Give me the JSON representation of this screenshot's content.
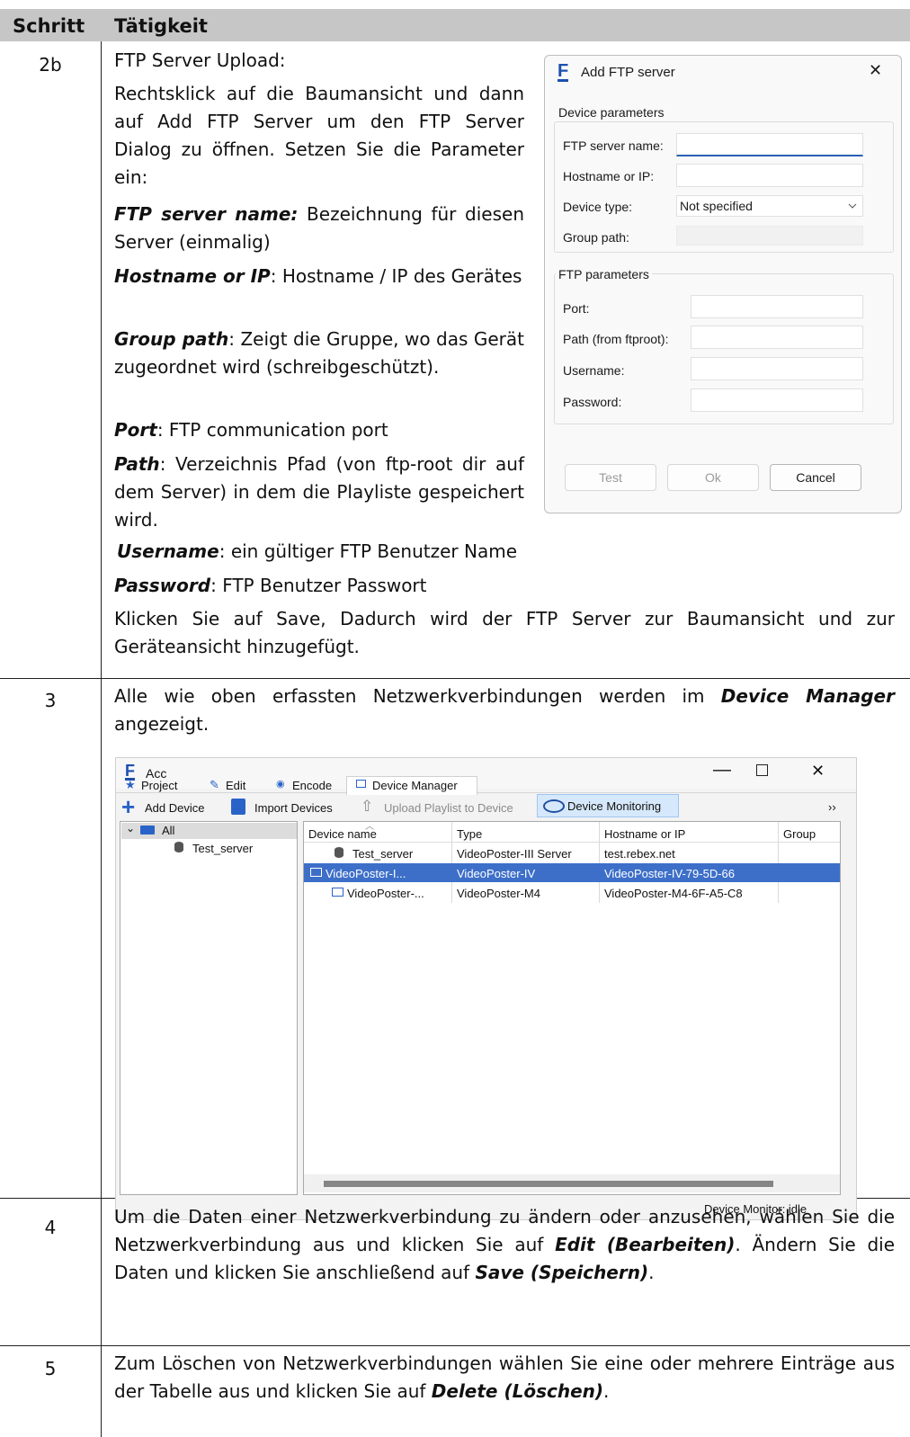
{
  "header": {
    "col_step": "Schritt",
    "col_activity": "Tätigkeit"
  },
  "step_2b": {
    "num": "2b",
    "title": "FTP Server Upload:",
    "intro": "Rechtsklick auf die Baumansicht und dann auf Add FTP Server um den FTP Server Dialog zu öffnen. Setzen Sie die Parameter ein:",
    "items": [
      {
        "term": "FTP server name:",
        "text": " Bezeichnung für diesen Server (einmalig)"
      },
      {
        "term": "Hostname or IP",
        "text": ": Hostname / IP des Gerätes"
      },
      {
        "term": "Group path",
        "text": ": Zeigt die Gruppe, wo das Gerät zugeordnet wird (schreibgeschützt)."
      },
      {
        "term": "Port",
        "text": ": FTP communication port"
      },
      {
        "term": "Path",
        "text": ": Verzeichnis Pfad (von ftp-root dir auf dem Server) in dem die Playliste gespeichert wird."
      },
      {
        "term": "Username",
        "text": ": ein gültiger FTP Benutzer Name"
      },
      {
        "term": "Password",
        "text": ": FTP Benutzer Passwort"
      }
    ],
    "outro": "Klicken Sie auf Save, Dadurch wird der FTP Server zur Baumansicht und zur Geräteansicht hinzugefügt."
  },
  "ftp_dialog": {
    "logo": "F",
    "title": "Add FTP server",
    "close": "✕",
    "device_group": "Device parameters",
    "ftp_name_label": "FTP server name:",
    "hostname_label": "Hostname or IP:",
    "device_type_label": "Device type:",
    "device_type_value": "Not specified",
    "group_path_label": "Group path:",
    "ftp_group": "FTP parameters",
    "port_label": "Port:",
    "path_label": "Path (from ftproot):",
    "username_label": "Username:",
    "password_label": "Password:",
    "btn_test": "Test",
    "btn_ok": "Ok",
    "btn_cancel": "Cancel"
  },
  "step_3": {
    "num": "3",
    "text_a": "Alle wie oben erfassten Netzwerkverbindungen werden im ",
    "term": "Device Manager",
    "text_b": " angezeigt."
  },
  "acc_window": {
    "logo": "F",
    "title": "Acc",
    "tabs": [
      {
        "icon": "star-icon",
        "label": "Project"
      },
      {
        "icon": "pencil-icon",
        "label": "Edit"
      },
      {
        "icon": "eye-icon",
        "label": "Encode"
      },
      {
        "icon": "monitor-icon",
        "label": "Device Manager"
      }
    ],
    "toolbar": {
      "add": "Add Device",
      "import": "Import Devices",
      "upload": "Upload Playlist to Device",
      "monitoring": "Device Monitoring",
      "more": "››"
    },
    "tree": {
      "root": "All",
      "child": "Test_server"
    },
    "columns": [
      "Device name",
      "Type",
      "Hostname or IP",
      "Group"
    ],
    "rows": [
      {
        "name": "Test_server",
        "type": "VideoPoster-III Server",
        "host": "test.rebex.net",
        "group": "",
        "icon": "database-icon"
      },
      {
        "name": "VideoPoster-I...",
        "type": "VideoPoster-IV",
        "host": "VideoPoster-IV-79-5D-66",
        "group": "",
        "icon": "monitor-icon"
      },
      {
        "name": "VideoPoster-...",
        "type": "VideoPoster-M4",
        "host": "VideoPoster-M4-6F-A5-C8",
        "group": "",
        "icon": "monitor-icon"
      }
    ],
    "selected_row": 1,
    "status": "Device Monitor: idle",
    "accent": "#3d6fc9"
  },
  "step_4": {
    "num": "4",
    "text_a": "Um die Daten einer Netzwerkverbindung zu ändern oder anzusehen, wählen Sie die Netzwerkverbindung aus und klicken Sie auf ",
    "term_a": "Edit (Bearbeiten)",
    "text_b": ". Ändern Sie die Daten und klicken Sie anschließend auf ",
    "term_b": "Save (Speichern)",
    "text_c": "."
  },
  "step_5": {
    "num": "5",
    "text_a": "Zum Löschen von Netzwerkverbindungen wählen Sie eine oder mehrere Einträge aus der Tabelle aus und klicken Sie auf ",
    "term": "Delete (Löschen)",
    "text_b": "."
  }
}
